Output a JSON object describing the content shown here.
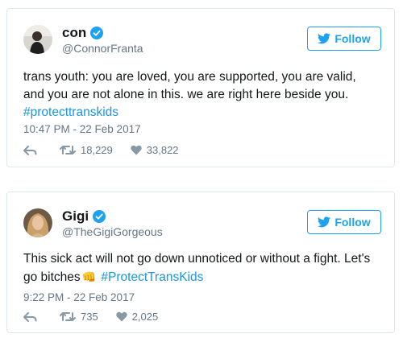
{
  "colors": {
    "accent": "#1da1f2",
    "hashtag": "#1b95e0",
    "muted": "#657786"
  },
  "tweets": [
    {
      "name": "con",
      "handle": "@ConnorFranta",
      "follow_label": "Follow",
      "text_main": "trans youth: you are loved, you are supported, you are valid, and you are not alone in this. we are right here beside you.",
      "hashtag": "#protecttranskids",
      "timestamp": "10:47 PM - 22 Feb 2017",
      "retweets": "18,229",
      "likes": "33,822"
    },
    {
      "name": "Gigi",
      "handle": "@TheGigiGorgeous",
      "follow_label": "Follow",
      "text_main": "This sick act will not go down unnoticed or without a fight. Let's go bitches",
      "emoji": "👊",
      "hashtag": "#ProtectTransKids",
      "timestamp": "9:22 PM - 22 Feb 2017",
      "retweets": "735",
      "likes": "2,025"
    }
  ]
}
